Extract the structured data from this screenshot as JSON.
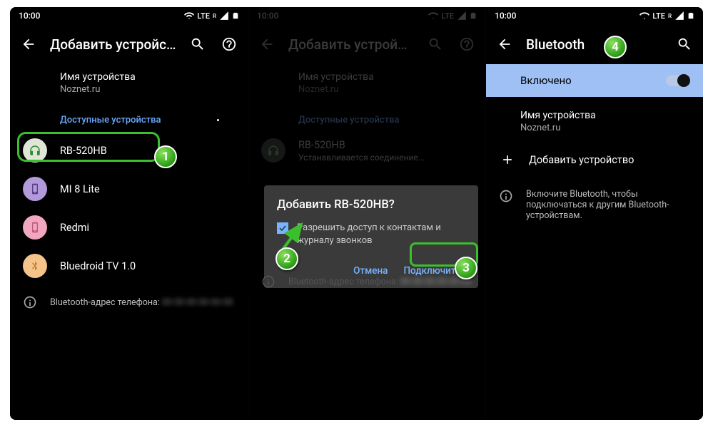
{
  "status": {
    "time": "10:00",
    "network": "LTE",
    "subscript": "R"
  },
  "panel1": {
    "title": "Добавить устройство",
    "device_name_label": "Имя устройства",
    "device_name_value": "Noznet.ru",
    "available_header": "Доступные устройства",
    "devices": [
      {
        "name": "RB-520HB"
      },
      {
        "name": "MI 8 Lite"
      },
      {
        "name": "Redmi"
      },
      {
        "name": "Bluedroid TV 1.0"
      }
    ],
    "bt_address_label": "Bluetooth-адрес телефона:"
  },
  "panel2": {
    "title": "Добавить устройство",
    "device_name_label": "Имя устройства",
    "device_name_value": "Noznet.ru",
    "available_header": "Доступные устройства",
    "connecting_device": "RB-520HB",
    "connecting_status": "Устанавливается соединение...",
    "bt_address_label": "Bluetooth-адрес телефона:",
    "dialog": {
      "title": "Добавить RB-520HB?",
      "checkbox_label": "Разрешить доступ к контактам и журналу звонков",
      "cancel": "Отмена",
      "connect": "Подключить"
    }
  },
  "panel3": {
    "title": "Bluetooth",
    "enabled_label": "Включено",
    "device_name_label": "Имя устройства",
    "device_name_value": "Noznet.ru",
    "add_device": "Добавить устройство",
    "help_text": "Включите Bluetooth, чтобы подключаться к другим Bluetooth-устройствам."
  },
  "steps": {
    "s1": "1",
    "s2": "2",
    "s3": "3",
    "s4": "4"
  }
}
